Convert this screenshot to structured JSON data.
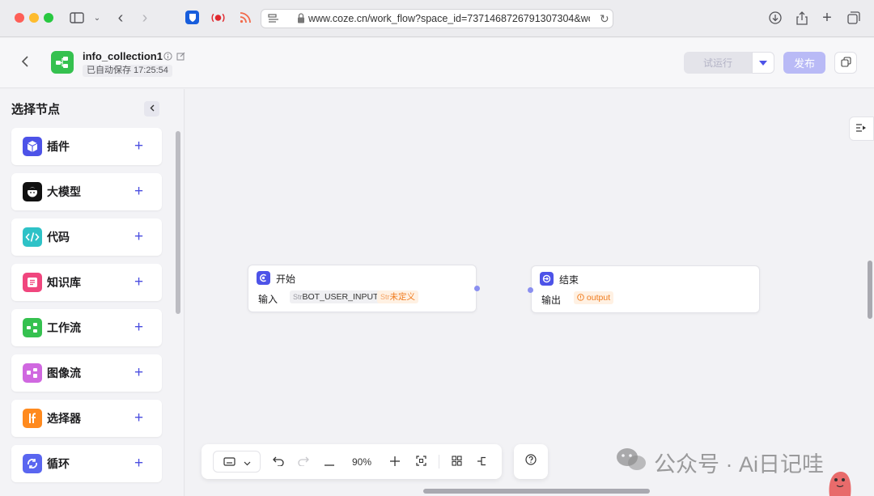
{
  "browser": {
    "url": "www.coze.cn/work_flow?space_id=7371468726791307304&work"
  },
  "header": {
    "app_title": "info_collection1",
    "autosave": "已自动保存 17:25:54",
    "test_run_label": "试运行",
    "publish_label": "发布"
  },
  "sidebar": {
    "title": "选择节点",
    "items": [
      {
        "label": "插件",
        "color": "#4d53e8",
        "icon": "cube-icon"
      },
      {
        "label": "大模型",
        "color": "#111111",
        "icon": "llm-face-icon"
      },
      {
        "label": "代码",
        "color": "#2ec2c7",
        "icon": "code-icon"
      },
      {
        "label": "知识库",
        "color": "#f0467e",
        "icon": "knowledge-icon"
      },
      {
        "label": "工作流",
        "color": "#35c14f",
        "icon": "workflow-icon"
      },
      {
        "label": "图像流",
        "color": "#d068e0",
        "icon": "imageflow-icon"
      },
      {
        "label": "选择器",
        "color": "#ff8a1e",
        "icon": "if-icon"
      },
      {
        "label": "循环",
        "color": "#5a66f0",
        "icon": "loop-icon"
      }
    ]
  },
  "nodes": {
    "start": {
      "title": "开始",
      "input_label": "输入",
      "var_type": "Str",
      "var_name": "BOT_USER_INPUT",
      "undefined_type": "Str",
      "undefined_label": "未定义"
    },
    "end": {
      "title": "结束",
      "output_label": "输出",
      "output_var": "output"
    }
  },
  "toolbar": {
    "zoom": "90%"
  },
  "watermark": {
    "text": "公众号 · Ai日记哇"
  }
}
